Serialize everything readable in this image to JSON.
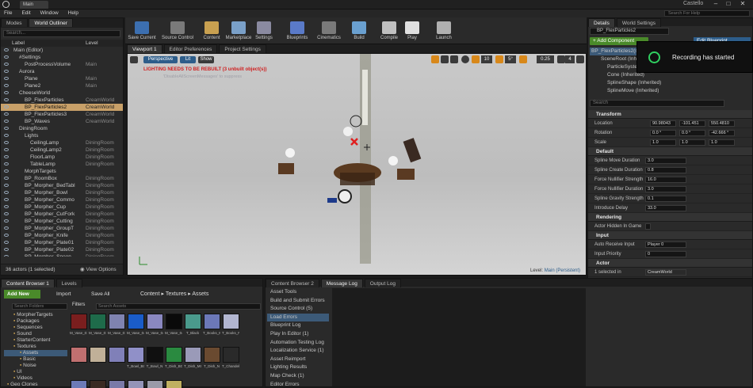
{
  "window": {
    "title": "Main",
    "user": "Castello",
    "search_placeholder": "Search For Help",
    "close": "✕",
    "minimize": "–",
    "maximize": "□"
  },
  "menu": [
    "File",
    "Edit",
    "Window",
    "Help"
  ],
  "left_tabs": [
    "Modes",
    "World Outliner"
  ],
  "outliner": {
    "search_placeholder": "Search...",
    "col_label": "Label",
    "col_level": "Level",
    "rows": [
      {
        "label": "Main (Editor)",
        "level": "",
        "indent": 0
      },
      {
        "label": "#Settings",
        "level": "",
        "indent": 1
      },
      {
        "label": "PostProcessVolume",
        "level": "Main",
        "indent": 2
      },
      {
        "label": "Aurora",
        "level": "",
        "indent": 1
      },
      {
        "label": "Plane",
        "level": "Main",
        "indent": 2
      },
      {
        "label": "Plane2",
        "level": "Main",
        "indent": 2
      },
      {
        "label": "CheeseWorld",
        "level": "",
        "indent": 1
      },
      {
        "label": "BP_FlexParticles",
        "level": "CreamWorld",
        "indent": 2
      },
      {
        "label": "BP_FlexParticles2",
        "level": "CreamWorld",
        "indent": 2,
        "selected": true
      },
      {
        "label": "BP_FlexParticles3",
        "level": "CreamWorld",
        "indent": 2
      },
      {
        "label": "BP_Waves",
        "level": "CreamWorld",
        "indent": 2
      },
      {
        "label": "DiningRoom",
        "level": "",
        "indent": 1
      },
      {
        "label": "Lights",
        "level": "",
        "indent": 2
      },
      {
        "label": "CeilingLamp",
        "level": "DiningRoom",
        "indent": 3
      },
      {
        "label": "CeilingLamp2",
        "level": "DiningRoom",
        "indent": 3
      },
      {
        "label": "FloorLamp",
        "level": "DiningRoom",
        "indent": 3
      },
      {
        "label": "TableLamp",
        "level": "DiningRoom",
        "indent": 3
      },
      {
        "label": "MorphTargets",
        "level": "",
        "indent": 2
      },
      {
        "label": "BP_RoomBox",
        "level": "DiningRoom",
        "indent": 2
      },
      {
        "label": "BP_Morpher_BedTabl",
        "level": "DiningRoom",
        "indent": 2
      },
      {
        "label": "BP_Morpher_Bowl",
        "level": "DiningRoom",
        "indent": 2
      },
      {
        "label": "BP_Morpher_Commo",
        "level": "DiningRoom",
        "indent": 2
      },
      {
        "label": "BP_Morpher_Cup",
        "level": "DiningRoom",
        "indent": 2
      },
      {
        "label": "BP_Morpher_CutFork",
        "level": "DiningRoom",
        "indent": 2
      },
      {
        "label": "BP_Morpher_Cutting",
        "level": "DiningRoom",
        "indent": 2
      },
      {
        "label": "BP_Morpher_GroupT",
        "level": "DiningRoom",
        "indent": 2
      },
      {
        "label": "BP_Morpher_Knife",
        "level": "DiningRoom",
        "indent": 2
      },
      {
        "label": "BP_Morpher_Plate01",
        "level": "DiningRoom",
        "indent": 2
      },
      {
        "label": "BP_Morpher_Plate02",
        "level": "DiningRoom",
        "indent": 2
      },
      {
        "label": "BP_Morpher_Spoon",
        "level": "DiningRoom",
        "indent": 2
      },
      {
        "label": "BP_Morpher_Table",
        "level": "DiningRoom",
        "indent": 2
      }
    ],
    "status": "36 actors (1 selected)",
    "view_options": "View Options"
  },
  "toolbar": [
    "Save Current",
    "Source Control",
    "Content",
    "Marketplace",
    "Settings",
    "Blueprints",
    "Cinematics",
    "Build",
    "Compile",
    "Play",
    "Launch"
  ],
  "viewport_tabs": [
    "Viewport 1",
    "Editor Preferences",
    "Project Settings"
  ],
  "viewport": {
    "perspective": "Perspective",
    "lit": "Lit",
    "show": "Show",
    "warning": "LIGHTING NEEDS TO BE REBUILT (3 unbuilt object(s))",
    "warning2": "'DisableAllScreenMessages' to suppress",
    "snap1": "10",
    "snap2": "5°",
    "snap3": "0.25",
    "snap4": "4",
    "level_label": "Level:",
    "level_value": "Main (Persistent)"
  },
  "details": {
    "tabs": [
      "Details",
      "World Settings"
    ],
    "actor_name": "BP_FlexParticles2",
    "add_component": "+ Add Component",
    "edit_blueprint": "Edit Blueprint",
    "components": [
      "BP_FlexParticles2(self)",
      "SceneRoot (Inherited)",
      "ParticleSystem (Inherited)",
      "Cone (Inherited)",
      "SplineShape (Inherited)",
      "SplineMove (Inherited)"
    ],
    "search_placeholder": "Search",
    "transform": {
      "header": "Transform",
      "location": [
        "90.98043",
        "-101.451",
        "550.4810"
      ],
      "rotation": [
        "0.0 °",
        "0.0 °",
        "-42.666 °"
      ],
      "scale": [
        "1.0",
        "1.0",
        "1.0"
      ],
      "labels": [
        "Location",
        "Rotation",
        "Scale"
      ]
    },
    "default": {
      "header": "Default",
      "rows": [
        [
          "Spline Move Duration",
          "3.0"
        ],
        [
          "Spline Create Duration",
          "0.8"
        ],
        [
          "Force Nullifier Strength",
          "16.0"
        ],
        [
          "Force Nullifier Duration",
          "3.0"
        ],
        [
          "Spline Gravity Strength",
          "0.1"
        ],
        [
          "Introduce Delay",
          "33.0"
        ]
      ]
    },
    "rendering": {
      "header": "Rendering",
      "rows": [
        [
          "Actor Hidden In Game",
          ""
        ]
      ]
    },
    "input": {
      "header": "Input",
      "rows": [
        [
          "Auto Receive Input",
          "Player 0"
        ],
        [
          "Input Priority",
          "0"
        ]
      ]
    },
    "actor": {
      "header": "Actor",
      "selected": "1 selected in",
      "selected_value": "CreamWorld",
      "convert": "Convert Actor",
      "convert_value": "Select a Type",
      "rows": [
        [
          "Can be Damaged",
          ""
        ],
        [
          "Generate Overlap Events",
          ""
        ],
        [
          "Spawn Collision Handlin",
          "Always Spawn, Ignore Collisions"
        ],
        [
          "Initial Life Span",
          "0.0"
        ]
      ]
    }
  },
  "recording": {
    "text": "Recording has started"
  },
  "bottom_tabs": [
    "Content Browser 1",
    "Levels"
  ],
  "content_browser": {
    "add_new": "Add New",
    "import": "Import",
    "save_all": "Save All",
    "breadcrumb": [
      "Content",
      "Textures",
      "Assets"
    ],
    "search_folders": "Search Folders",
    "filters": "Filters",
    "search_assets": "Search Assets",
    "folders": [
      "MorpherTargets",
      "Packages",
      "Sequences",
      "Sound",
      "StarterContent",
      "Textures",
      "Assets",
      "Basic",
      "Noise",
      "UI",
      "Videos",
      "Geo Clones"
    ],
    "asset_colors": [
      "#7a1e1e",
      "#1e6b4a",
      "#7f83b0",
      "#1a5cc8",
      "#8a88c0",
      "#0a0a0a",
      "#4a9a8c",
      "#6c78b8",
      "#b2b6d0",
      "#c07070",
      "#c0b098",
      "#8080b8",
      "#9090c8",
      "#101010",
      "#2a8a40",
      "#9a9ab8",
      "#6a4a30",
      "#2a2a2a",
      "#6c7ab8",
      "#3a2a22",
      "#7a7aa8",
      "#9494b8",
      "#9a9aa8",
      "#c0b060"
    ],
    "asset_labels": [
      "M_Vase_01_BC",
      "M_Vase_01_MSR",
      "M_Vase_01_N",
      "M_Vase_04_BC",
      "M_Vase_04_MSR",
      "M_Vase_04_N",
      "T_Black",
      "T_Books_MSR",
      "T_Books_N",
      "",
      "",
      "",
      "T_Bowl_BC",
      "T_Bowl_N",
      "T_Dish_BC",
      "T_Dish_MSR",
      "T_Dish_N",
      "T_Chandelier_BC",
      "T_Chandelier_MSR",
      "T_Chandelier_N",
      "T_Chess_BC",
      "",
      "",
      ""
    ]
  },
  "mid_tabs": [
    "Content Browser 2",
    "Message Log",
    "Output Log"
  ],
  "log_categories": [
    "Asset Tools",
    "Build and Submit Errors",
    "Source Control (5)",
    "Load Errors",
    "Blueprint Log",
    "Play In Editor (1)",
    "Automation Testing Log",
    "Localization Service (1)",
    "Asset Reimport",
    "Lighting Results",
    "Map Check (1)",
    "Editor Errors"
  ]
}
